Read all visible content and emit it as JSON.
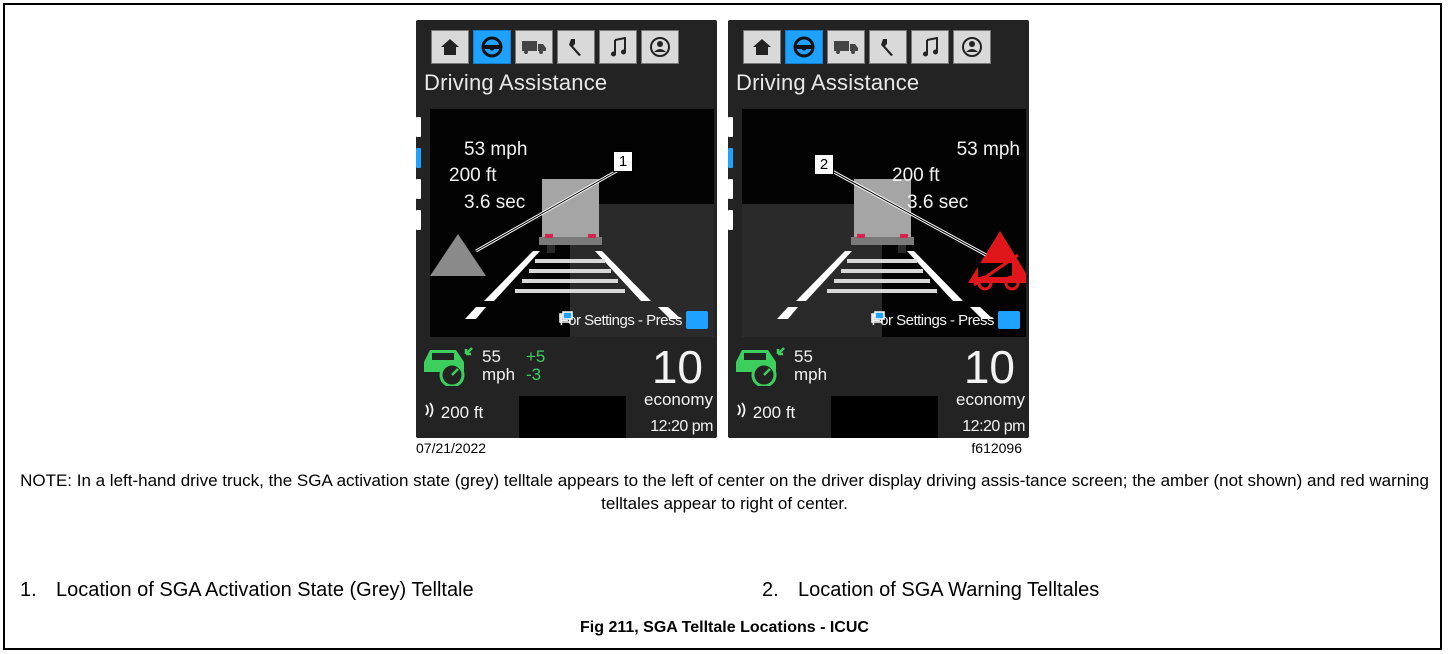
{
  "screens": [
    {
      "title": "Driving Assistance",
      "speed": "53",
      "speed_unit": "mph",
      "distance": "200",
      "distance_unit": "ft",
      "time_gap": "3.6",
      "time_unit": "sec",
      "settings_text": "For Settings - Press",
      "set_speed": "55",
      "set_speed_unit": "mph",
      "offset_plus": "+5",
      "offset_minus": "-3",
      "gear": "10",
      "mode": "economy",
      "follow_distance": "200 ft",
      "time": "12:20 pm",
      "callout": "1",
      "telltale_color": "#8a8a8a"
    },
    {
      "title": "Driving Assistance",
      "speed": "53",
      "speed_unit": "mph",
      "distance": "200",
      "distance_unit": "ft",
      "time_gap": "3.6",
      "time_unit": "sec",
      "settings_text": "For Settings - Press",
      "set_speed": "55",
      "set_speed_unit": "mph",
      "gear": "10",
      "mode": "economy",
      "follow_distance": "200 ft",
      "time": "12:20 pm",
      "callout": "2",
      "telltale_color": "#e0161a"
    }
  ],
  "tab_icons": [
    "home-icon",
    "steering-wheel-icon",
    "truck-icon",
    "wrench-icon",
    "music-icon",
    "driver-icon"
  ],
  "colors": {
    "accent": "#1ea1ff",
    "acc_green": "#3dcf5e",
    "truck_marker": "#d6244e"
  },
  "figure_date": "07/21/2022",
  "figure_code": "f612096",
  "note": "NOTE: In a left-hand drive truck, the SGA activation state (grey) telltale appears to the left of center on the driver display driving assis-tance screen; the amber (not shown) and red warning telltales appear to right of center.",
  "legend": [
    {
      "number": "1.",
      "text": "Location of SGA Activation State (Grey) Telltale"
    },
    {
      "number": "2.",
      "text": "Location of SGA Warning Telltales"
    }
  ],
  "caption": "Fig 211, SGA Telltale Locations - ICUC"
}
